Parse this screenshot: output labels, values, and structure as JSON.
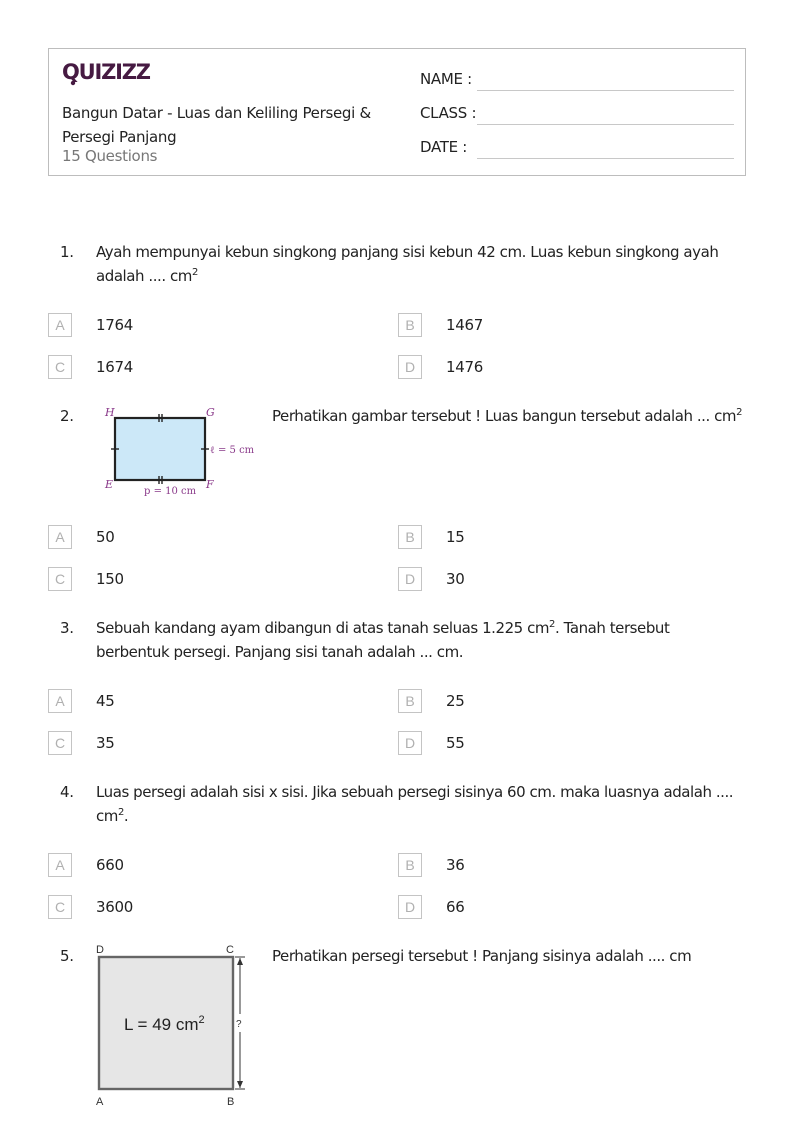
{
  "header": {
    "logo_text": "QUIZIZZ",
    "logo_color": "#461a42",
    "title": "Bangun Datar - Luas dan Keliling Persegi & Persegi Panjang",
    "question_count": "15 Questions",
    "fields": [
      {
        "label": "NAME :"
      },
      {
        "label": "CLASS :"
      },
      {
        "label": "DATE  :"
      }
    ]
  },
  "questions": [
    {
      "number": "1.",
      "text": "Ayah mempunyai kebun singkong panjang sisi kebun 42 cm. Luas kebun singkong ayah adalah .... cm",
      "sup": "2",
      "suffix": "",
      "options": [
        {
          "letter": "A",
          "value": "1764"
        },
        {
          "letter": "B",
          "value": "1467"
        },
        {
          "letter": "C",
          "value": "1674"
        },
        {
          "letter": "D",
          "value": "1476"
        }
      ]
    },
    {
      "number": "2.",
      "text": "Perhatikan gambar tersebut ! Luas bangun tersebut adalah ... cm",
      "sup": "2",
      "suffix": "",
      "figure": {
        "type": "rectangle",
        "vertices": [
          "H",
          "G",
          "E",
          "F"
        ],
        "width_label": "p = 10 cm",
        "height_label": "ℓ = 5 cm",
        "fill": "#cce8f8",
        "label_color": "#8a3a8a"
      },
      "options": [
        {
          "letter": "A",
          "value": "50"
        },
        {
          "letter": "B",
          "value": "15"
        },
        {
          "letter": "C",
          "value": "150"
        },
        {
          "letter": "D",
          "value": "30"
        }
      ]
    },
    {
      "number": "3.",
      "text": "Sebuah kandang ayam dibangun di atas tanah seluas 1.225 cm",
      "sup": "2",
      "suffix": ". Tanah tersebut berbentuk persegi. Panjang sisi tanah adalah ... cm.",
      "options": [
        {
          "letter": "A",
          "value": "45"
        },
        {
          "letter": "B",
          "value": "25"
        },
        {
          "letter": "C",
          "value": "35"
        },
        {
          "letter": "D",
          "value": "55"
        }
      ]
    },
    {
      "number": "4.",
      "text": "Luas persegi adalah sisi x sisi. Jika sebuah persegi sisinya 60 cm. maka luasnya adalah .... cm",
      "sup": "2",
      "suffix": ".",
      "options": [
        {
          "letter": "A",
          "value": "660"
        },
        {
          "letter": "B",
          "value": "36"
        },
        {
          "letter": "C",
          "value": "3600"
        },
        {
          "letter": "D",
          "value": "66"
        }
      ]
    },
    {
      "number": "5.",
      "text": "Perhatikan persegi tersebut ! Panjang sisinya adalah .... cm",
      "sup": "",
      "suffix": "",
      "figure": {
        "type": "square",
        "vertices": [
          "D",
          "C",
          "A",
          "B"
        ],
        "area_label": "L = 49 cm",
        "area_sup": "2",
        "side_label": "?",
        "fill": "#e6e6e6"
      }
    }
  ]
}
